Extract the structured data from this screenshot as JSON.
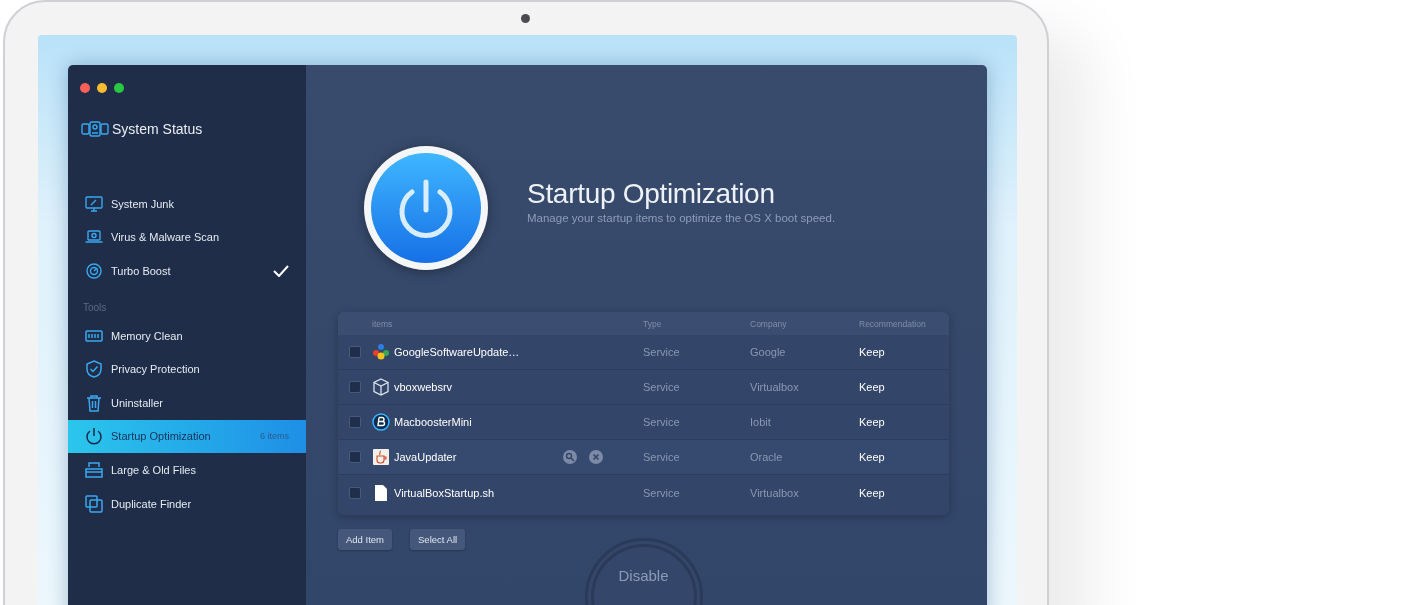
{
  "window": {
    "title": "System Status"
  },
  "sidebar": {
    "items": [
      {
        "label": "System Junk",
        "selected": false,
        "checked": false
      },
      {
        "label": "Virus & Malware Scan",
        "selected": false,
        "checked": false
      },
      {
        "label": "Turbo Boost",
        "selected": false,
        "checked": true
      }
    ],
    "tools_heading": "Tools",
    "tools": [
      {
        "label": "Memory Clean",
        "selected": false
      },
      {
        "label": "Privacy Protection",
        "selected": false
      },
      {
        "label": "Uninstaller",
        "selected": false
      },
      {
        "label": "Startup Optimization",
        "selected": true,
        "badge": "6 items"
      },
      {
        "label": "Large & Old Files",
        "selected": false
      },
      {
        "label": "Duplicate Finder",
        "selected": false
      }
    ]
  },
  "header": {
    "title": "Startup Optimization",
    "subtitle": "Manage your startup items to optimize the OS X boot speed."
  },
  "table": {
    "columns": [
      "items",
      "Type",
      "Company",
      "Recommendation"
    ],
    "rows": [
      {
        "checked": false,
        "hovered": false,
        "name": "GoogleSoftwareUpdate…",
        "type": "Service",
        "company": "Google",
        "recommendation": "Keep"
      },
      {
        "checked": false,
        "hovered": false,
        "name": "vboxwebsrv",
        "type": "Service",
        "company": "Virtualbox",
        "recommendation": "Keep"
      },
      {
        "checked": false,
        "hovered": false,
        "name": "MacboosterMini",
        "type": "Service",
        "company": "Iobit",
        "recommendation": "Keep"
      },
      {
        "checked": false,
        "hovered": true,
        "name": "JavaUpdater",
        "type": "Service",
        "company": "Oracle",
        "recommendation": "Keep"
      },
      {
        "checked": false,
        "hovered": false,
        "name": "VirtualBoxStartup.sh",
        "type": "Service",
        "company": "Virtualbox",
        "recommendation": "Keep"
      }
    ]
  },
  "buttons": [
    "Add Item",
    "Select All"
  ],
  "disable_button": {
    "label": "Disable",
    "disabled": true
  }
}
